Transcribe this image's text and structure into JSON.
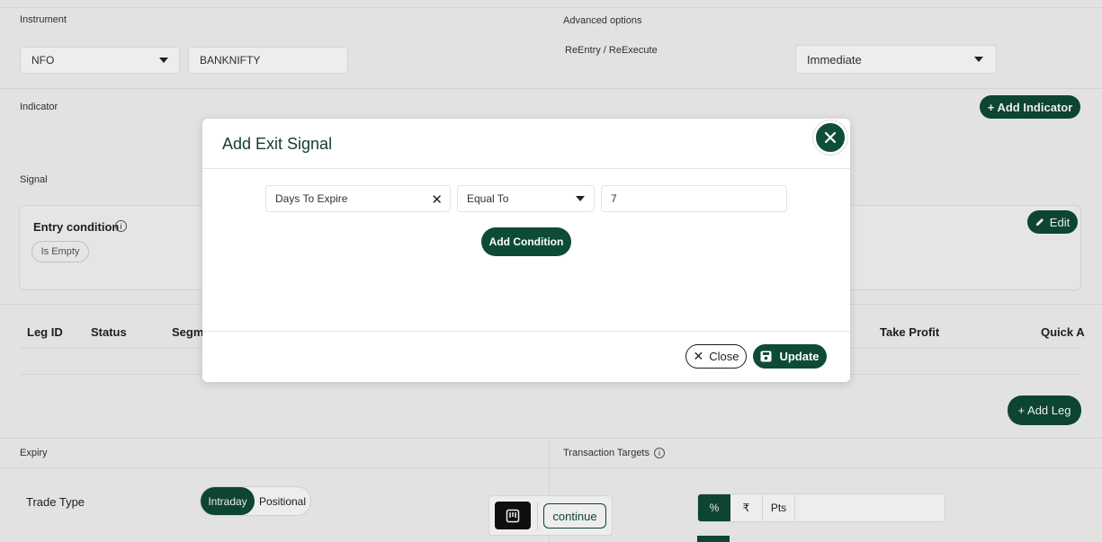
{
  "instrument": {
    "label": "Instrument",
    "exchange": "NFO",
    "symbol": "BANKNIFTY"
  },
  "advanced": {
    "label": "Advanced options",
    "reentry_label": "ReEntry / ReExecute",
    "reentry_value": "Immediate"
  },
  "indicator": {
    "label": "Indicator",
    "add_button": "+ Add Indicator"
  },
  "signal": {
    "label": "Signal",
    "entry_condition": "Entry condition",
    "is_empty": "Is Empty",
    "edit_button": "Edit"
  },
  "legs_table": {
    "headers": [
      "Leg ID",
      "Status",
      "Segm",
      "Take Profit",
      "Quick A"
    ],
    "add_leg_button": "+ Add Leg"
  },
  "expiry": {
    "label": "Expiry"
  },
  "transaction_targets": {
    "label": "Transaction Targets",
    "row_label_fragment": "s",
    "unit_options": [
      "%",
      "₹",
      "Pts"
    ]
  },
  "trade_type": {
    "label": "Trade Type",
    "options": [
      "Intraday",
      "Positional"
    ],
    "selected": "Intraday"
  },
  "bottom_bar": {
    "continue_label": "continue"
  },
  "modal": {
    "title": "Add Exit Signal",
    "condition": {
      "field": "Days To Expire",
      "operator": "Equal To",
      "value": "7"
    },
    "add_condition_button": "Add Condition",
    "close_button": "Close",
    "update_button": "Update"
  },
  "colors": {
    "accent": "#0e4a38",
    "background": "#f3f4f3"
  }
}
